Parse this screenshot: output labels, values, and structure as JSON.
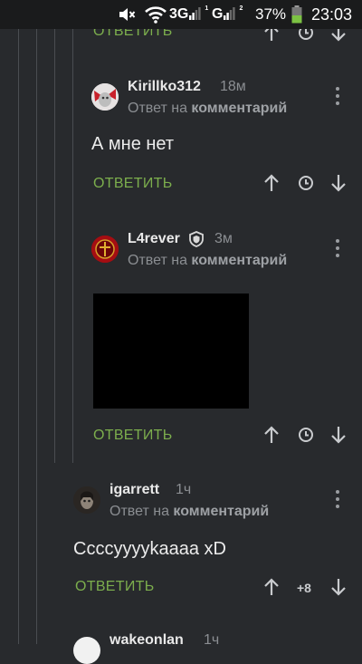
{
  "status_bar": {
    "network1": "3G",
    "network1_sim": "1",
    "network2": "G",
    "network2_sim": "2",
    "battery": "37%",
    "time": "23:03"
  },
  "top_actions": {
    "reply_label": "ОТВЕТИТЬ"
  },
  "comments": [
    {
      "username": "Kirillko312",
      "time": "18м",
      "reply_prefix": "Ответ на",
      "reply_link": "комментарий",
      "text": "А мне нет",
      "reply_label": "ОТВЕТИТЬ"
    },
    {
      "username": "L4rever",
      "time": "3м",
      "reply_prefix": "Ответ на",
      "reply_link": "комментарий",
      "reply_label": "ОТВЕТИТЬ"
    },
    {
      "username": "igarrett",
      "time": "1ч",
      "reply_prefix": "Ответ на",
      "reply_link": "комментарий",
      "text": "Ссссууууkaaaa xD",
      "reply_label": "ОТВЕТИТЬ",
      "rating": "+8"
    },
    {
      "username": "wakeonlan",
      "time": "1ч"
    }
  ],
  "colors": {
    "background": "#282a2d",
    "accent_green": "#7cae4d",
    "muted_text": "#8b8e92",
    "status_bar": "#1a1b1c"
  },
  "icons": [
    "mute-icon",
    "wifi-icon",
    "signal-icon",
    "battery-icon",
    "arrow-up-icon",
    "clock-icon",
    "arrow-down-icon",
    "more-vertical-icon",
    "shield-badge-icon"
  ]
}
